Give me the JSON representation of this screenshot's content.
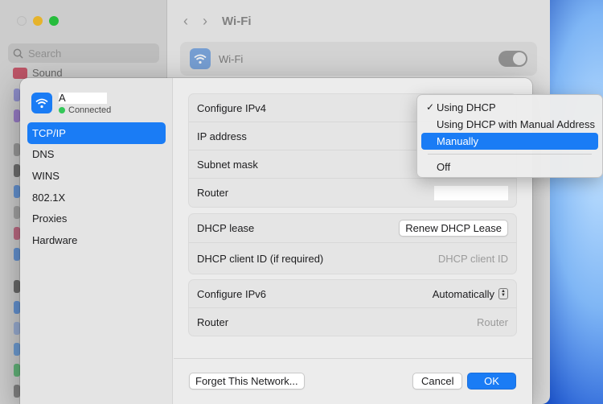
{
  "background_window": {
    "title": "Wi-Fi",
    "search_placeholder": "Search",
    "sidebar_visible_item": "Sound",
    "wifi_row_label": "Wi-Fi"
  },
  "network": {
    "name": "A",
    "status": "Connected"
  },
  "sidebar": {
    "items": [
      {
        "label": "TCP/IP",
        "active": true
      },
      {
        "label": "DNS",
        "active": false
      },
      {
        "label": "WINS",
        "active": false
      },
      {
        "label": "802.1X",
        "active": false
      },
      {
        "label": "Proxies",
        "active": false
      },
      {
        "label": "Hardware",
        "active": false
      }
    ]
  },
  "ipv4_group": {
    "configure_label": "Configure IPv4",
    "ip_label": "IP address",
    "subnet_label": "Subnet mask",
    "router_label": "Router"
  },
  "dhcp_group": {
    "lease_label": "DHCP lease",
    "renew_button": "Renew DHCP Lease",
    "client_id_label": "DHCP client ID (if required)",
    "client_id_placeholder": "DHCP client ID"
  },
  "ipv6_group": {
    "configure_label": "Configure IPv6",
    "configure_value": "Automatically",
    "router_label": "Router",
    "router_placeholder": "Router"
  },
  "footer": {
    "forget_button": "Forget This Network...",
    "cancel_button": "Cancel",
    "ok_button": "OK"
  },
  "ipv4_menu": {
    "options": [
      {
        "label": "Using DHCP",
        "checked": true,
        "highlighted": false
      },
      {
        "label": "Using DHCP with Manual Address",
        "checked": false,
        "highlighted": false
      },
      {
        "label": "Manually",
        "checked": false,
        "highlighted": true
      },
      {
        "label": "Off",
        "checked": false,
        "highlighted": false
      }
    ],
    "check_glyph": "✓"
  },
  "colors": {
    "accent": "#1a7cf5",
    "connected": "#34c759"
  }
}
